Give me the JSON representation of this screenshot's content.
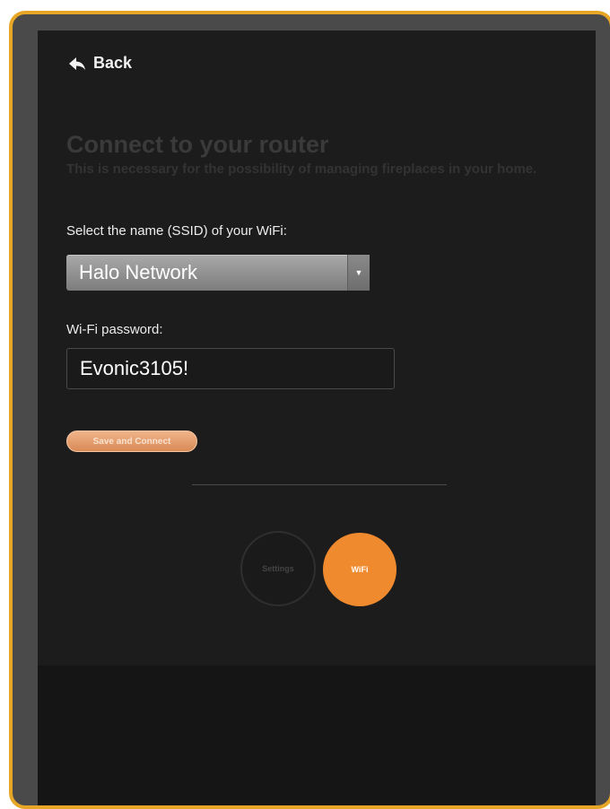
{
  "nav": {
    "back_label": "Back"
  },
  "header": {
    "title": "Connect to your router",
    "subtitle": "This is necessary for the possibility of managing fireplaces in your home."
  },
  "form": {
    "ssid_label": "Select the name (SSID) of your WiFi:",
    "ssid_value": "Halo Network",
    "password_label": "Wi-Fi password:",
    "password_value": "Evonic3105!",
    "save_label": "Save and Connect"
  },
  "steps": [
    {
      "label": "Settings",
      "active": false
    },
    {
      "label": "WiFi",
      "active": true
    }
  ],
  "icons": {
    "back": "back-arrow-icon",
    "dropdown": "chevron-down-icon"
  },
  "colors": {
    "frame": "#e8a626",
    "accent": "#f08a2e",
    "screen_bg": "#1c1c1c",
    "save_button": "#e8a27a"
  }
}
